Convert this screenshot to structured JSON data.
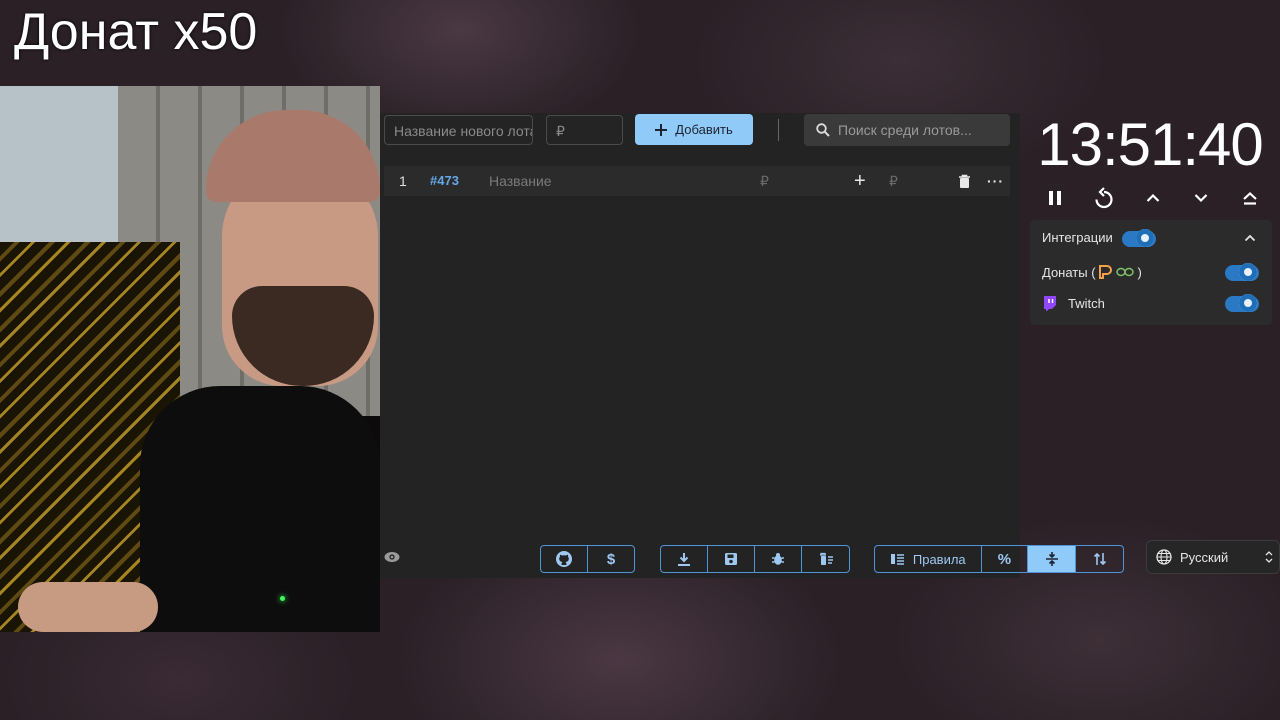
{
  "overlay": {
    "title": "Донат x50"
  },
  "toolbar": {
    "new_lot_placeholder": "Название нового лота",
    "amount_placeholder": "₽",
    "add_label": "Добавить",
    "search_placeholder": "Поиск среди лотов..."
  },
  "lots": [
    {
      "index": "1",
      "id": "#473",
      "name": "Название",
      "amount_currency": "₽",
      "add_currency": "₽"
    }
  ],
  "bottom_toolbar": {
    "rules_label": "Правила"
  },
  "timer": {
    "time": "13:51:40"
  },
  "integrations": {
    "title": "Интеграции",
    "donations_label": "Донаты (",
    "donations_close": ")",
    "twitch_label": "Twitch",
    "integrations_on": true,
    "donations_on": true,
    "twitch_on": true
  },
  "language": {
    "selected": "Русский"
  },
  "colors": {
    "accent": "#90caf9",
    "toggle": "#2979c4",
    "panel": "#232323",
    "lot_id": "#64a6e8",
    "twitch": "#9146ff"
  }
}
